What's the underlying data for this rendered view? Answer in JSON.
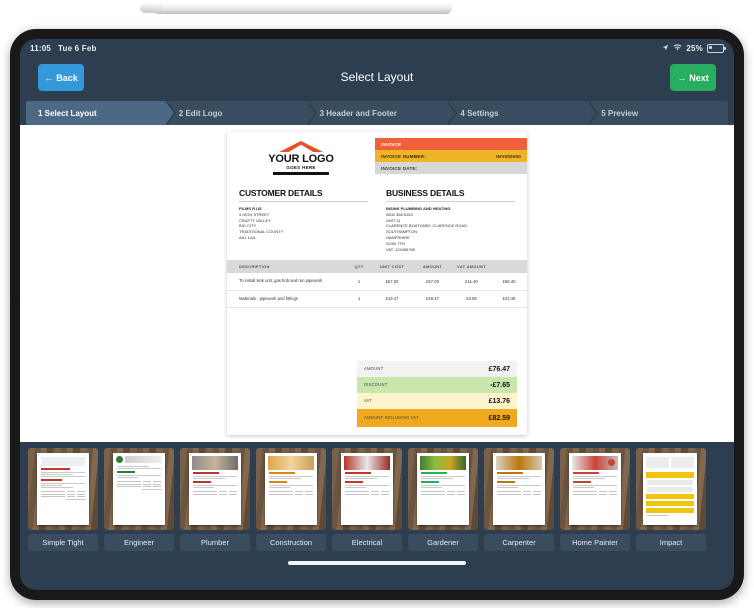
{
  "status_bar": {
    "time": "11:05",
    "date": "Tue 6 Feb",
    "battery_percent": "25%",
    "location_icon": "location-arrow-icon",
    "wifi_icon": "wifi-icon",
    "battery_icon": "battery-icon"
  },
  "nav": {
    "back_label": "Back",
    "back_icon": "arrow-left-icon",
    "title": "Select Layout",
    "next_label": "Next",
    "next_icon": "arrow-right-icon",
    "back_color": "#3498db",
    "next_color": "#27ae60"
  },
  "steps": [
    {
      "label": "1 Select Layout",
      "active": true
    },
    {
      "label": "2 Edit Logo",
      "active": false
    },
    {
      "label": "3 Header and Footer",
      "active": false
    },
    {
      "label": "4 Settings",
      "active": false
    },
    {
      "label": "5 Preview",
      "active": false
    }
  ],
  "invoice": {
    "logo": {
      "main": "YOUR LOGO",
      "sub": "GOES HERE",
      "roof_color": "#e8502a"
    },
    "header_rows": [
      {
        "label": "INVOICE",
        "value": "",
        "color": "#f0603a"
      },
      {
        "label": "INVOICE NUMBER:",
        "value": "INV000000",
        "color": "#f0b429"
      },
      {
        "label": "INVOICE DATE:",
        "value": "",
        "color": "#d7d7d7"
      }
    ],
    "customer": {
      "heading": "CUSTOMER DETAILS",
      "name": "FILMS R US",
      "lines": [
        "3 HIGH STREET",
        "CRAFTY VALLEY",
        "BIG CITY",
        "TRADITIONAL COUNTY",
        "AA1 1AA"
      ]
    },
    "business": {
      "heading": "BUSINESS DETAILS",
      "name": "INSINK PLUMBING AND HEATING",
      "lines": [
        "0800 368 8153",
        "UNIT 11",
        "CLARENCE BOATYARD, CLARENCE ROAD",
        "SOUTHAMPTON",
        "HAMPSHIRE",
        "SO55 7TH",
        "VAT: 123456789"
      ]
    },
    "table": {
      "columns": [
        "DESCRIPTION",
        "QTY",
        "UNIT COST",
        "AMOUNT",
        "VAT AMOUNT",
        ""
      ],
      "rows": [
        {
          "description": "To install sink unit, gas hob and run pipework",
          "qty": "1",
          "unit_cost": "£57.00",
          "amount": "£57.00",
          "vat_amount": "£11.40",
          "total": "£68.40"
        },
        {
          "description": "Materials - pipework and fittings",
          "qty": "1",
          "unit_cost": "£19.47",
          "amount": "£19.47",
          "vat_amount": "£3.89",
          "total": "£23.36"
        }
      ]
    },
    "totals": [
      {
        "label": "AMOUNT",
        "value": "£76.47",
        "color": "#f2f2f2"
      },
      {
        "label": "DISCOUNT",
        "value": "-£7.65",
        "color": "#c9e6ad"
      },
      {
        "label": "VAT",
        "value": "£13.76",
        "color": "#fbf4cd"
      },
      {
        "label": "AMOUNT INCLUDING VAT",
        "value": "£82.59",
        "color": "#f0a91e"
      }
    ]
  },
  "carousel": {
    "items": [
      {
        "label": "Simple Tight",
        "accent": "#c0392b",
        "style": "plain"
      },
      {
        "label": "Engineer",
        "accent": "#2e7d32",
        "style": "sketch"
      },
      {
        "label": "Plumber",
        "accent": "#b03a2e",
        "style": "photo"
      },
      {
        "label": "Construction",
        "accent": "#d68910",
        "style": "photo"
      },
      {
        "label": "Electrical",
        "accent": "#c0392b",
        "style": "photo"
      },
      {
        "label": "Gardener",
        "accent": "#27ae60",
        "style": "photo"
      },
      {
        "label": "Carpenter",
        "accent": "#b9770e",
        "style": "photo"
      },
      {
        "label": "Home Painter",
        "accent": "#cb4335",
        "style": "photo"
      },
      {
        "label": "Impact",
        "accent": "#f1c40f",
        "style": "yellow"
      }
    ]
  }
}
